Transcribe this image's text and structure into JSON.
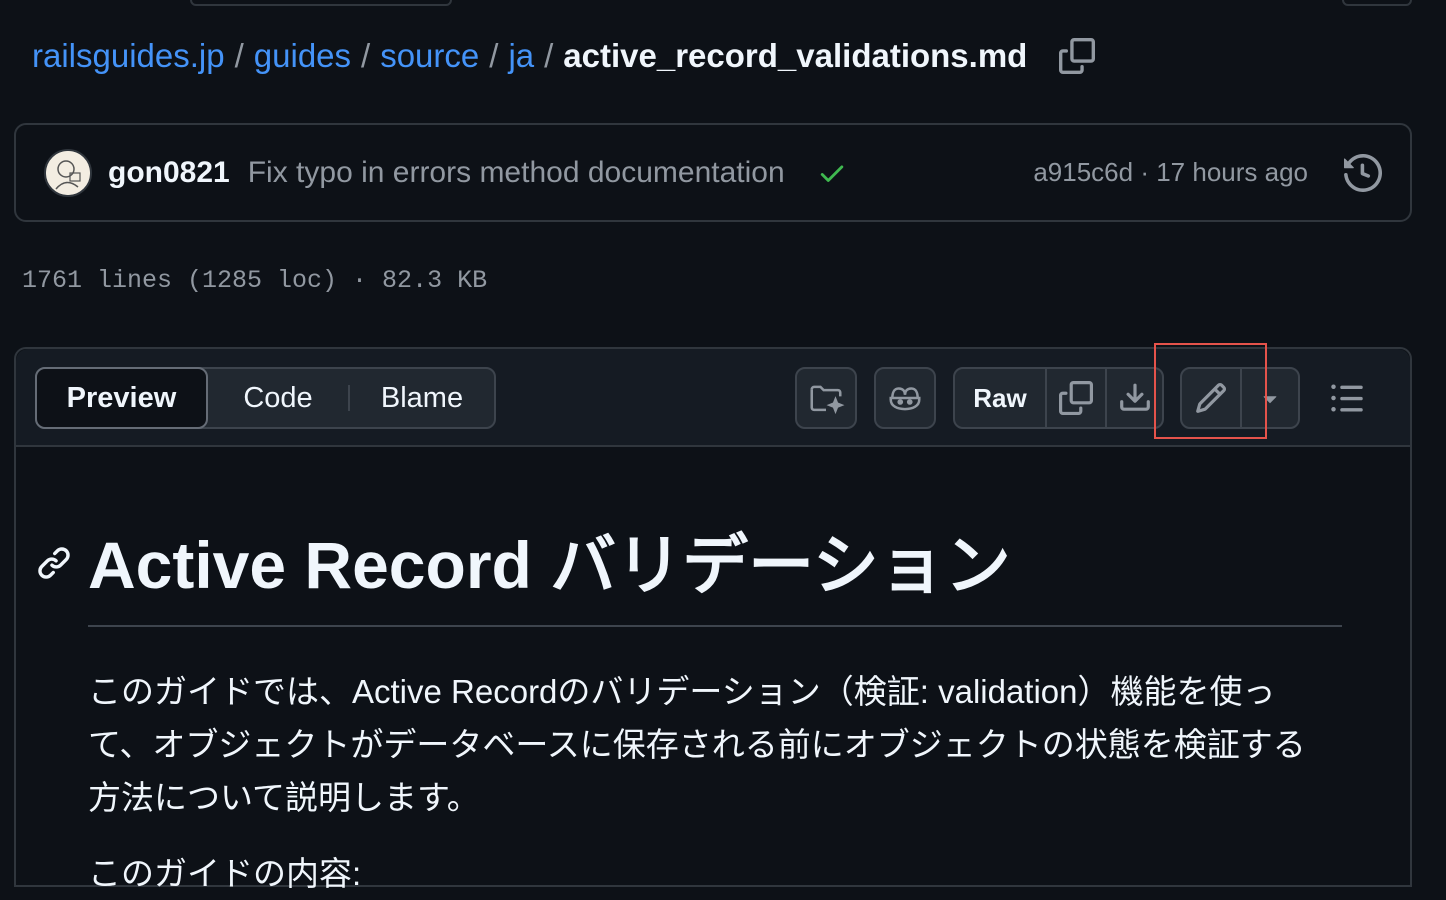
{
  "breadcrumb": {
    "items": [
      "railsguides.jp",
      "guides",
      "source",
      "ja"
    ],
    "separator": "/",
    "current": "active_record_validations.md"
  },
  "commit": {
    "author": "gon0821",
    "message": "Fix typo in errors method documentation",
    "status": "success",
    "meta": "a915c6d · 17 hours ago"
  },
  "file_info": "1761 lines (1285 loc) · 82.3 KB",
  "toolbar": {
    "tabs": [
      {
        "label": "Preview",
        "active": true
      },
      {
        "label": "Code",
        "active": false
      },
      {
        "label": "Blame",
        "active": false
      }
    ],
    "raw_label": "Raw",
    "icons": [
      "folder-sparkle-icon",
      "copilot-icon",
      "copy-icon",
      "download-icon",
      "pencil-icon",
      "triangle-down-icon",
      "list-unordered-icon"
    ]
  },
  "highlight": {
    "target": "edit-file-button",
    "color": "#e5534b"
  },
  "content": {
    "heading": "Active Record バリデーション",
    "paragraph": "このガイドでは、Active Recordのバリデーション（検証: validation）機能を使って、オブジェクトがデータベースに保存される前にオブジェクトの状態を検証する方法について説明します。",
    "next_line_partial": "このガイドの内容:"
  },
  "colors": {
    "background": "#0d1117",
    "link": "#4493f8",
    "border": "#30363d",
    "success": "#3fb950"
  }
}
